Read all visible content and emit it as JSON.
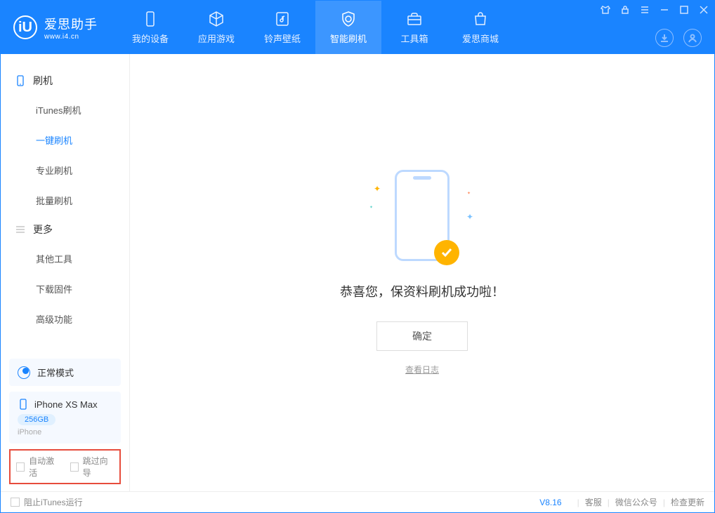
{
  "app": {
    "name": "爱思助手",
    "url": "www.i4.cn"
  },
  "nav": {
    "items": [
      {
        "label": "我的设备"
      },
      {
        "label": "应用游戏"
      },
      {
        "label": "铃声壁纸"
      },
      {
        "label": "智能刷机"
      },
      {
        "label": "工具箱"
      },
      {
        "label": "爱思商城"
      }
    ]
  },
  "sidebar": {
    "group1": {
      "title": "刷机"
    },
    "items1": [
      {
        "label": "iTunes刷机"
      },
      {
        "label": "一键刷机"
      },
      {
        "label": "专业刷机"
      },
      {
        "label": "批量刷机"
      }
    ],
    "group2": {
      "title": "更多"
    },
    "items2": [
      {
        "label": "其他工具"
      },
      {
        "label": "下载固件"
      },
      {
        "label": "高级功能"
      }
    ]
  },
  "device": {
    "mode": "正常模式",
    "name": "iPhone XS Max",
    "storage": "256GB",
    "type": "iPhone"
  },
  "options": {
    "auto_activate": "自动激活",
    "skip_guide": "跳过向导"
  },
  "main": {
    "message": "恭喜您，保资料刷机成功啦！",
    "confirm": "确定",
    "view_log": "查看日志"
  },
  "footer": {
    "block_itunes": "阻止iTunes运行",
    "version": "V8.16",
    "links": [
      "客服",
      "微信公众号",
      "检查更新"
    ]
  }
}
